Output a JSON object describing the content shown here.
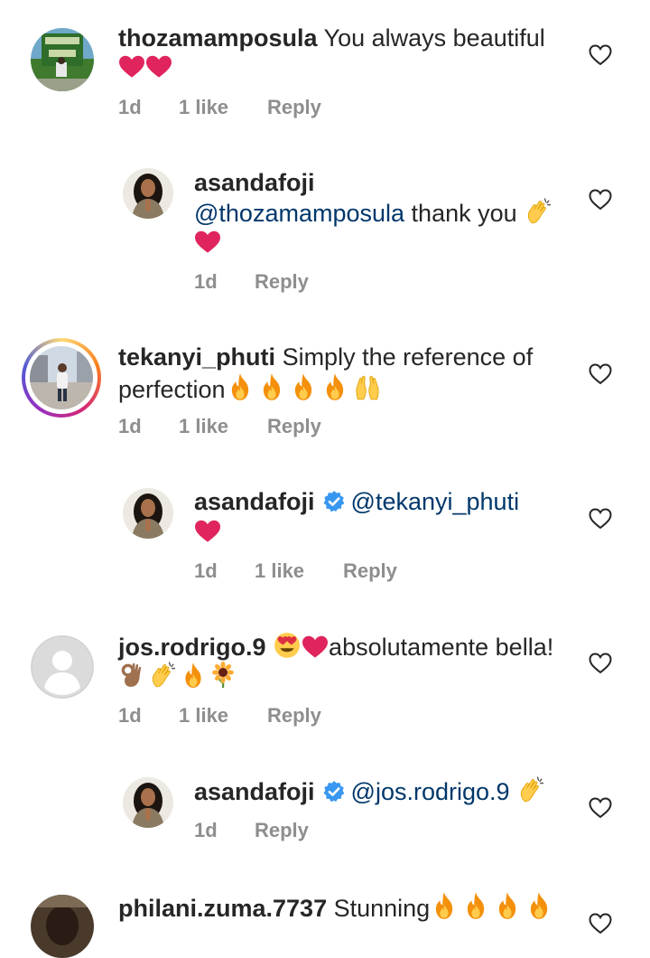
{
  "comments": [
    {
      "username": "thozamamposula",
      "text": "You always beautiful",
      "time": "1d",
      "likes": "1 like",
      "reply": "Reply"
    },
    {
      "username": "asandafoji",
      "mention": "@thozamamposula",
      "text": "thank you",
      "time": "1d",
      "reply": "Reply"
    },
    {
      "username": "tekanyi_phuti",
      "text": "Simply the reference of",
      "text_line2": "perfection",
      "time": "1d",
      "likes": "1 like",
      "reply": "Reply"
    },
    {
      "username": "asandafoji",
      "mention": "@tekanyi_phuti",
      "time": "1d",
      "likes": "1 like",
      "reply": "Reply"
    },
    {
      "username": "jos.rodrigo.9",
      "text": "absolutamente bella!",
      "time": "1d",
      "likes": "1 like",
      "reply": "Reply"
    },
    {
      "username": "asandafoji",
      "mention": "@jos.rodrigo.9",
      "time": "1d",
      "reply": "Reply"
    },
    {
      "username": "philani.zuma.7737",
      "text": "Stunning"
    }
  ],
  "colors": {
    "mention": "#00376b",
    "meta": "#8e8e8e",
    "heart_emoji": "#e0245e",
    "verified": "#3897f0"
  }
}
